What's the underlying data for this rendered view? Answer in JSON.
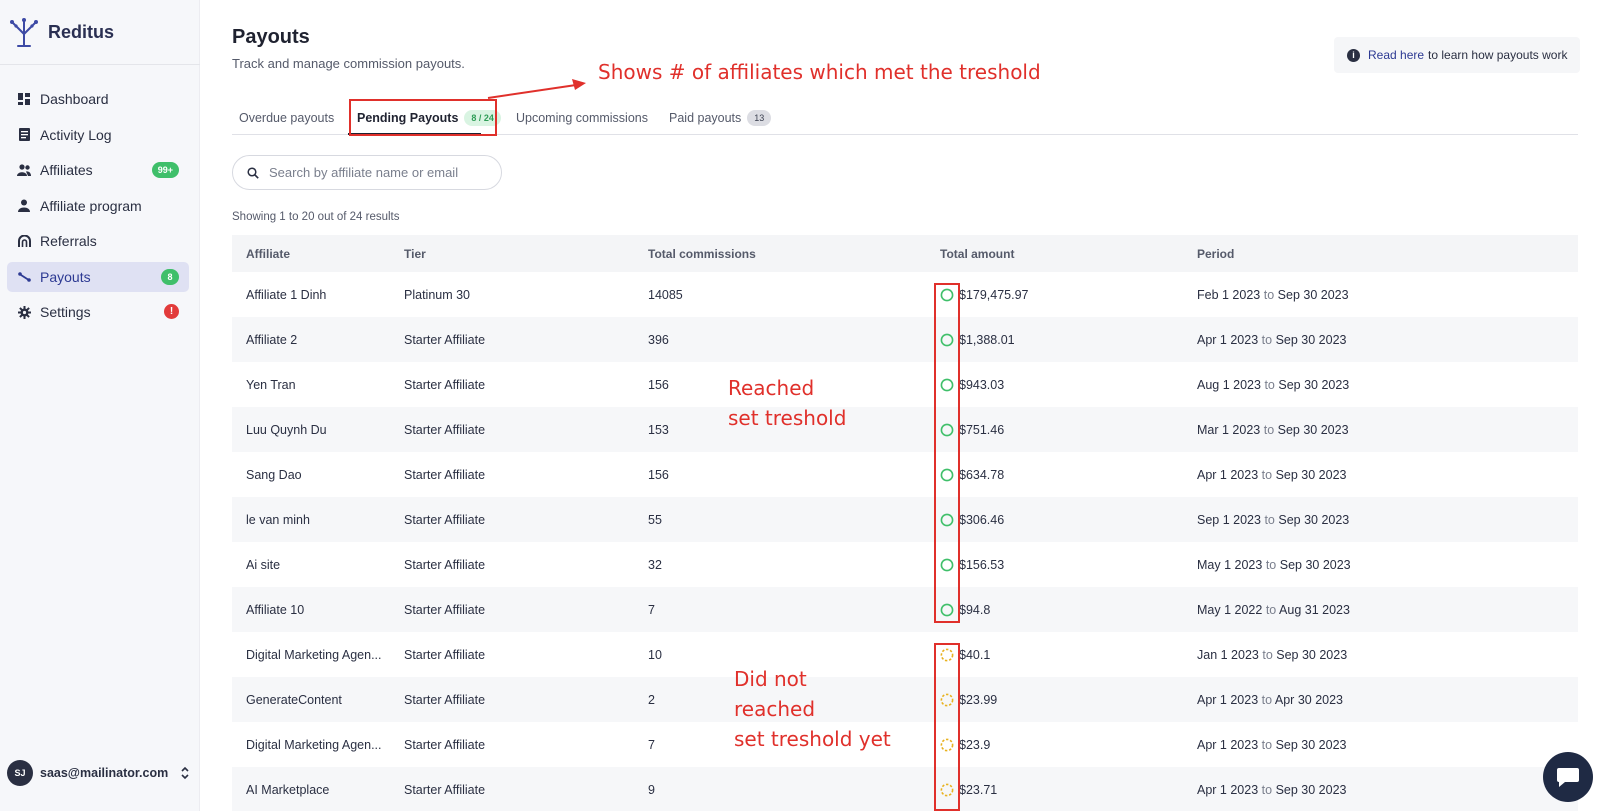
{
  "app": {
    "name": "Reditus"
  },
  "sidebar": {
    "items": [
      {
        "label": "Dashboard",
        "icon": "dashboard-icon"
      },
      {
        "label": "Activity Log",
        "icon": "document-icon"
      },
      {
        "label": "Affiliates",
        "icon": "users-icon",
        "badge": "99+"
      },
      {
        "label": "Affiliate program",
        "icon": "user-icon"
      },
      {
        "label": "Referrals",
        "icon": "referral-icon"
      },
      {
        "label": "Payouts",
        "icon": "payouts-icon",
        "badge": "8",
        "active": true
      },
      {
        "label": "Settings",
        "icon": "gear-icon",
        "alert": "!"
      }
    ],
    "user": {
      "initials": "SJ",
      "email": "saas@mailinator.com"
    }
  },
  "header": {
    "title": "Payouts",
    "subtitle": "Track and manage commission payouts.",
    "help_link": "Read here",
    "help_text": "to learn how payouts work"
  },
  "tabs": [
    {
      "label": "Overdue payouts"
    },
    {
      "label": "Pending Payouts",
      "count": "8 / 24",
      "active": true
    },
    {
      "label": "Upcoming commissions"
    },
    {
      "label": "Paid payouts",
      "count": "13"
    }
  ],
  "search": {
    "placeholder": "Search by affiliate name or email"
  },
  "results_text": "Showing 1 to 20 out of 24 results",
  "table": {
    "headers": {
      "affiliate": "Affiliate",
      "tier": "Tier",
      "commissions": "Total commissions",
      "amount": "Total amount",
      "period": "Period"
    },
    "period_joiner": "to",
    "rows": [
      {
        "affiliate": "Affiliate 1 Dinh",
        "tier": "Platinum 30",
        "commissions": "14085",
        "amount": "$179,475.97",
        "status": "reached",
        "from": "Feb 1 2023",
        "to": "Sep 30 2023"
      },
      {
        "affiliate": "Affiliate 2",
        "tier": "Starter Affiliate",
        "commissions": "396",
        "amount": "$1,388.01",
        "status": "reached",
        "from": "Apr 1 2023",
        "to": "Sep 30 2023"
      },
      {
        "affiliate": "Yen Tran",
        "tier": "Starter Affiliate",
        "commissions": "156",
        "amount": "$943.03",
        "status": "reached",
        "from": "Aug 1 2023",
        "to": "Sep 30 2023"
      },
      {
        "affiliate": "Luu Quynh Du",
        "tier": "Starter Affiliate",
        "commissions": "153",
        "amount": "$751.46",
        "status": "reached",
        "from": "Mar 1 2023",
        "to": "Sep 30 2023"
      },
      {
        "affiliate": "Sang Dao",
        "tier": "Starter Affiliate",
        "commissions": "156",
        "amount": "$634.78",
        "status": "reached",
        "from": "Apr 1 2023",
        "to": "Sep 30 2023"
      },
      {
        "affiliate": "le van minh",
        "tier": "Starter Affiliate",
        "commissions": "55",
        "amount": "$306.46",
        "status": "reached",
        "from": "Sep 1 2023",
        "to": "Sep 30 2023"
      },
      {
        "affiliate": "Ai site",
        "tier": "Starter Affiliate",
        "commissions": "32",
        "amount": "$156.53",
        "status": "reached",
        "from": "May 1 2023",
        "to": "Sep 30 2023"
      },
      {
        "affiliate": "Affiliate 10",
        "tier": "Starter Affiliate",
        "commissions": "7",
        "amount": "$94.8",
        "status": "reached",
        "from": "May 1 2022",
        "to": "Aug 31 2023"
      },
      {
        "affiliate": "Digital Marketing Agen...",
        "tier": "Starter Affiliate",
        "commissions": "10",
        "amount": "$40.1",
        "status": "pending",
        "from": "Jan 1 2023",
        "to": "Sep 30 2023"
      },
      {
        "affiliate": "GenerateContent",
        "tier": "Starter Affiliate",
        "commissions": "2",
        "amount": "$23.99",
        "status": "pending",
        "from": "Apr 1 2023",
        "to": "Apr 30 2023"
      },
      {
        "affiliate": "Digital Marketing Agen...",
        "tier": "Starter Affiliate",
        "commissions": "7",
        "amount": "$23.9",
        "status": "pending",
        "from": "Apr 1 2023",
        "to": "Sep 30 2023"
      },
      {
        "affiliate": "AI Marketplace",
        "tier": "Starter Affiliate",
        "commissions": "9",
        "amount": "$23.71",
        "status": "pending",
        "from": "Apr 1 2023",
        "to": "Sep 30 2023"
      }
    ]
  },
  "annotations": {
    "tab_note": "Shows # of affiliates which met the treshold",
    "reached_note": [
      "Reached",
      "set treshold"
    ],
    "not_reached_note": [
      "Did not",
      "reached",
      "set treshold yet"
    ]
  },
  "colors": {
    "accent": "#2d3a93",
    "reached": "#3fbf6a",
    "pending": "#e8b220",
    "annotation": "#e0302b"
  }
}
